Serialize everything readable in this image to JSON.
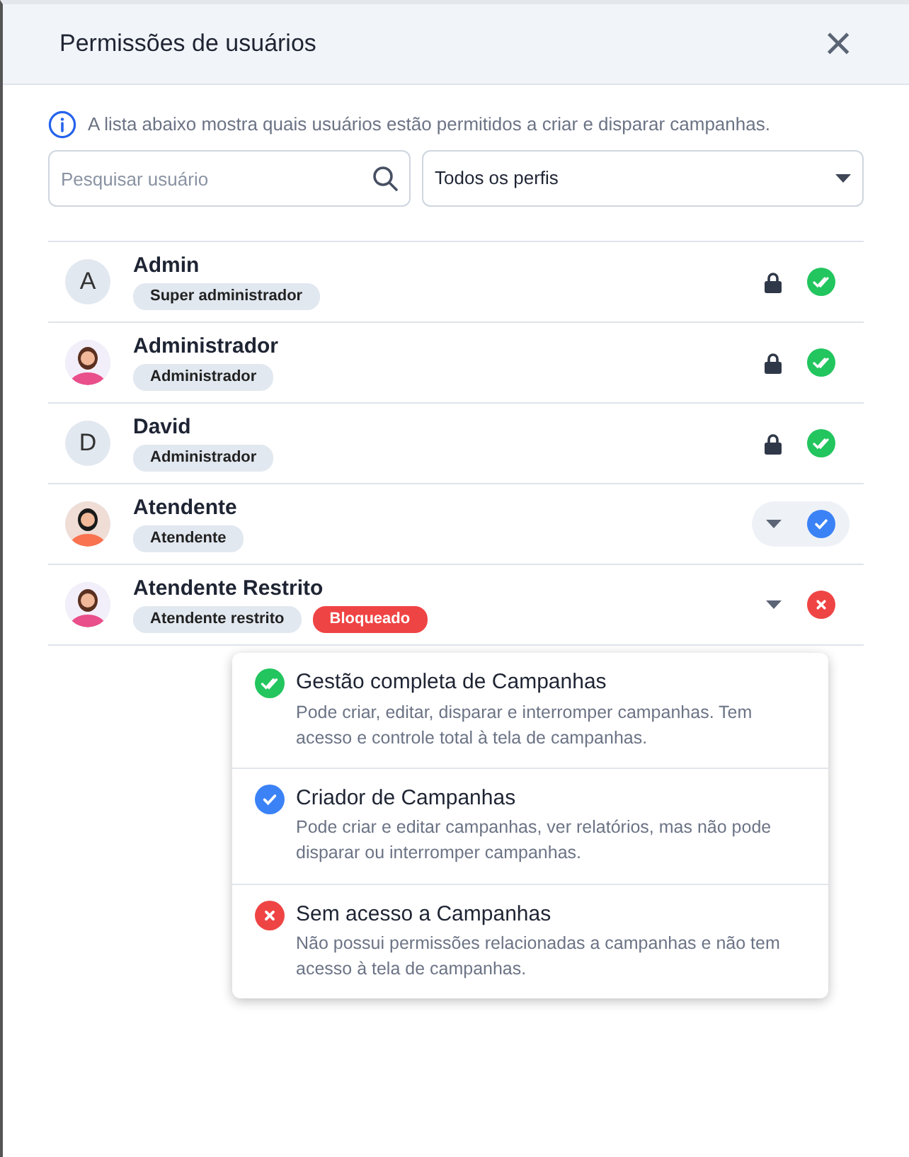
{
  "modal": {
    "title": "Permissões de usuários",
    "close": "×"
  },
  "info": "A lista abaixo mostra quais usuários estão permitidos a criar e disparar campanhas.",
  "search": {
    "placeholder": "Pesquisar usuário"
  },
  "profile_filter": {
    "value": "Todos os perfis"
  },
  "users": [
    {
      "name": "Admin",
      "avatar": {
        "kind": "letter",
        "letter": "A"
      },
      "badges": [
        {
          "text": "Super administrador",
          "kind": "role"
        }
      ],
      "locked": true,
      "kind": "full",
      "highlighted": false
    },
    {
      "name": "Administrador",
      "avatar": {
        "kind": "figure"
      },
      "badges": [
        {
          "text": "Administrador",
          "kind": "role"
        }
      ],
      "locked": true,
      "kind": "full",
      "highlighted": false
    },
    {
      "name": "David",
      "avatar": {
        "kind": "letter",
        "letter": "D"
      },
      "badges": [
        {
          "text": "Administrador",
          "kind": "role"
        }
      ],
      "locked": true,
      "kind": "full",
      "highlighted": false
    },
    {
      "name": "Atendente",
      "avatar": {
        "kind": "figure"
      },
      "badges": [
        {
          "text": "Atendente",
          "kind": "role"
        }
      ],
      "locked": false,
      "kind": "creator",
      "highlighted": true
    },
    {
      "name": "Atendente Restrito",
      "avatar": {
        "kind": "figure"
      },
      "badges": [
        {
          "text": "Atendente restrito",
          "kind": "role"
        },
        {
          "text": "Bloqueado",
          "kind": "blocked"
        }
      ],
      "locked": false,
      "kind": "none",
      "highlighted": false
    }
  ],
  "permission_menu": [
    {
      "kind": "full",
      "title": "Gestão completa de Campanhas",
      "description": "Pode criar, editar, disparar e interromper campanhas. Tem acesso e controle total à tela de campanhas."
    },
    {
      "kind": "creator",
      "title": "Criador de Campanhas",
      "description": "Pode criar e editar campanhas, ver relatórios, mas não pode disparar ou interromper campanhas."
    },
    {
      "kind": "none",
      "title": "Sem acesso a Campanhas",
      "description": "Não possui permissões relacionadas a campanhas e não tem acesso à tela de campanhas."
    }
  ]
}
